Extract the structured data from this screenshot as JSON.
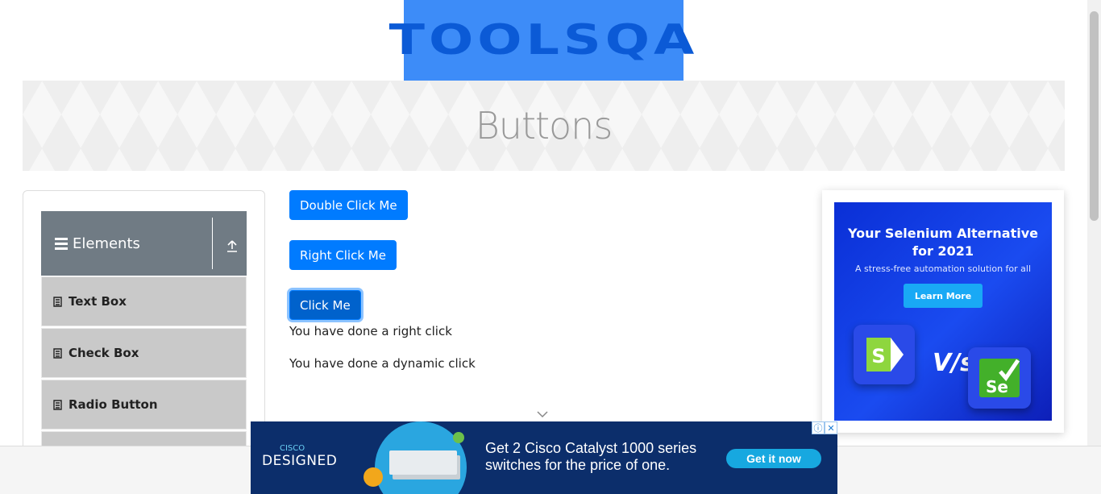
{
  "header": {
    "logo_text": "TOOLSQA"
  },
  "banner": {
    "title": "Buttons"
  },
  "sidebar": {
    "group_title": "Elements",
    "items": [
      {
        "label": "Text Box"
      },
      {
        "label": "Check Box"
      },
      {
        "label": "Radio Button"
      }
    ]
  },
  "buttons": {
    "double_click": "Double Click Me",
    "right_click": "Right Click Me",
    "click": "Click Me"
  },
  "messages": {
    "right_click": "You have done a right click",
    "dynamic_click": "You have done a dynamic click"
  },
  "right_ad": {
    "headline_1": "Your Selenium Alternative",
    "headline_2": "for 2021",
    "subline": "A stress-free automation solution for all",
    "cta": "Learn More",
    "vs": "V/s",
    "se": "Se"
  },
  "bottom_ad": {
    "brand_top": "CISCO",
    "brand": "DESIGNED",
    "copy_1": "Get 2 Cisco Catalyst 1000 series",
    "copy_2": "switches for the price of one.",
    "cta": "Get it now"
  },
  "colors": {
    "primary": "#007bff",
    "sidebar_header": "#707b84",
    "menu_item": "#c9c9c9",
    "logo_bg": "#3d8cf8"
  }
}
